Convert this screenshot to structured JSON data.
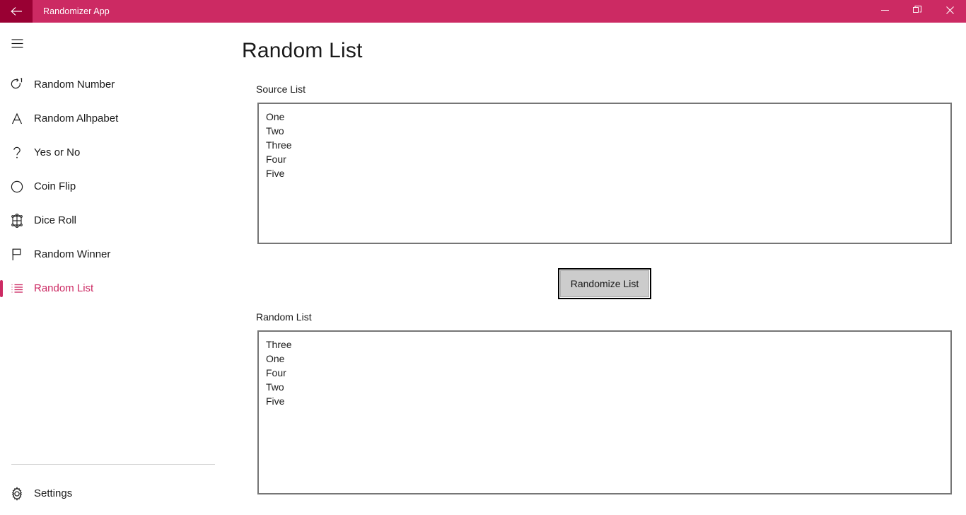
{
  "titlebar": {
    "back_icon": "back-arrow-icon",
    "app_title": "Randomizer App",
    "minimize_label": "–",
    "maximize_label": "restore-icon",
    "close_label": "×",
    "background_color": "#cc2a63",
    "back_button_color": "#990033"
  },
  "sidebar": {
    "hamburger_icon": "hamburger-menu-icon",
    "accent_color": "#cc2a63",
    "items": [
      {
        "label": "Random Number",
        "icon": "repeat-one-icon",
        "selected": false
      },
      {
        "label": "Random Alhpabet",
        "icon": "letter-a-icon",
        "selected": false
      },
      {
        "label": "Yes or No",
        "icon": "question-mark-icon",
        "selected": false
      },
      {
        "label": "Coin Flip",
        "icon": "circle-icon",
        "selected": false
      },
      {
        "label": "Dice Roll",
        "icon": "dice-icon",
        "selected": false
      },
      {
        "label": "Random Winner",
        "icon": "flag-icon",
        "selected": false
      },
      {
        "label": "Random List",
        "icon": "list-icon",
        "selected": true
      }
    ],
    "settings": {
      "label": "Settings",
      "icon": "gear-icon"
    }
  },
  "main": {
    "page_title": "Random List",
    "source": {
      "label": "Source List",
      "items": [
        "One",
        "Two",
        "Three",
        "Four",
        "Five"
      ],
      "value": "One\nTwo\nThree\nFour\nFive"
    },
    "randomize_button": {
      "label": "Randomize List"
    },
    "result": {
      "label": "Random List",
      "items": [
        "Three",
        "One",
        "Four",
        "Two",
        "Five"
      ],
      "value": "Three\nOne\nFour\nTwo\nFive"
    }
  }
}
